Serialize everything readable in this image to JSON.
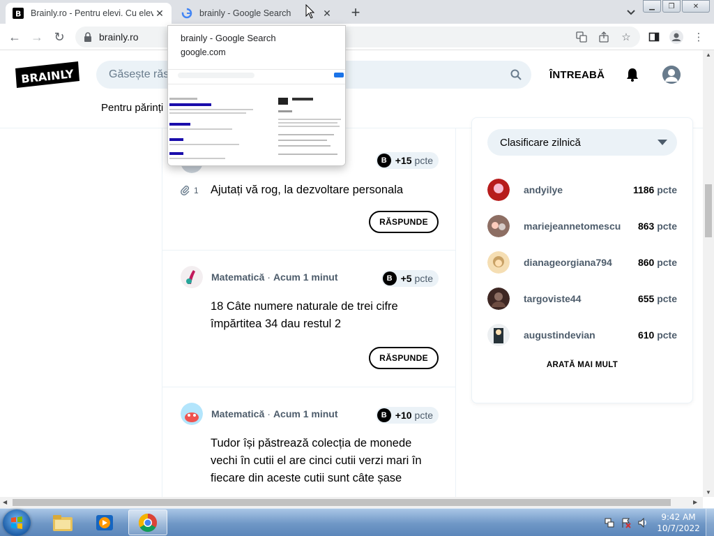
{
  "browser": {
    "tabs": [
      {
        "label": "Brainly.ro - Pentru elevi. Cu elevi.",
        "active": true
      },
      {
        "label": "brainly - Google Search",
        "active": false
      }
    ],
    "url": "brainly.ro",
    "new_tab": "+",
    "preview": {
      "title": "brainly - Google Search",
      "domain": "google.com"
    }
  },
  "header": {
    "logo_text": "BRAINLY",
    "search_placeholder": "Găsește răs",
    "ask_label": "ÎNTREABĂ",
    "subnav_label": "Pentru părinți"
  },
  "questions": [
    {
      "subject": "",
      "time": "",
      "points": "+15",
      "points_unit": "pcte",
      "attachments": "1",
      "text": "Ajutați vă rog, la dezvoltare personala",
      "answer_label": "RĂSPUNDE"
    },
    {
      "subject": "Matematică",
      "dot": "·",
      "time": "Acum 1 minut",
      "points": "+5",
      "points_unit": "pcte",
      "text": "18 Câte numere naturale de trei cifre împărtitea 34 dau restul 2",
      "answer_label": "RĂSPUNDE"
    },
    {
      "subject": "Matematică",
      "dot": "·",
      "time": "Acum 1 minut",
      "points": "+10",
      "points_unit": "pcte",
      "text": "Tudor își păstrează colecția de monede vechi în cutii el are cinci cutii verzi mari în fiecare din aceste cutii sunt câte șase"
    }
  ],
  "ranking": {
    "select_label": "Clasificare zilnică",
    "rows": [
      {
        "name": "andyilye",
        "points": "1186",
        "unit": "pcte"
      },
      {
        "name": "mariejeannetomescu",
        "points": "863",
        "unit": "pcte"
      },
      {
        "name": "dianageorgiana794",
        "points": "860",
        "unit": "pcte"
      },
      {
        "name": "targoviste44",
        "points": "655",
        "unit": "pcte"
      },
      {
        "name": "augustindevian",
        "points": "610",
        "unit": "pcte"
      }
    ],
    "show_more": "ARATĂ MAI MULT"
  },
  "taskbar": {
    "time": "9:42 AM",
    "date": "10/7/2022"
  },
  "colors": {
    "brand": "#000000",
    "search_bg": "#ebf2f7",
    "muted_text": "#4d5c6b",
    "tab_strip": "#dee1e6"
  }
}
